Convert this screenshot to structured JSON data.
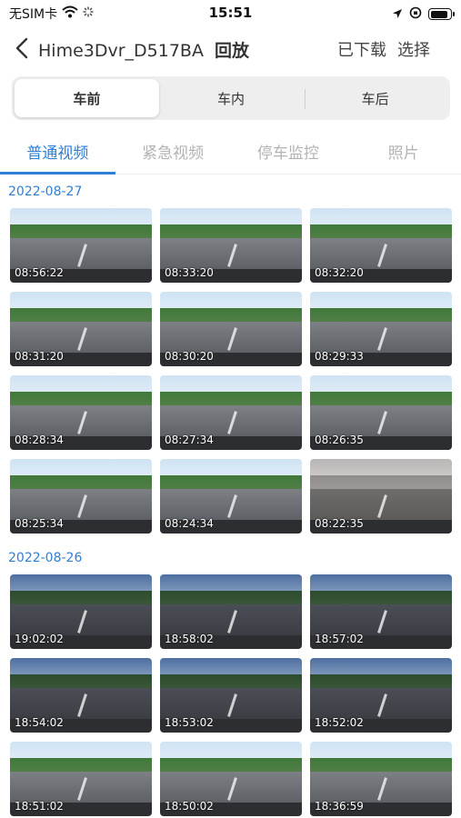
{
  "status_bar": {
    "carrier": "无SIM卡",
    "time": "15:51",
    "icons": [
      "wifi-icon",
      "activity-icon",
      "location-arrow-icon",
      "lock-rotation-icon",
      "battery-icon"
    ],
    "battery_level": 0.9
  },
  "nav": {
    "title": "Hime3Dvr_D517BA",
    "subtitle": "回放",
    "downloaded_label": "已下载",
    "select_label": "选择"
  },
  "camera_segments": [
    {
      "label": "车前",
      "active": true
    },
    {
      "label": "车内",
      "active": false
    },
    {
      "label": "车后",
      "active": false
    }
  ],
  "tabs": [
    {
      "label": "普通视频",
      "active": true
    },
    {
      "label": "紧急视频",
      "active": false
    },
    {
      "label": "停车监控",
      "active": false
    },
    {
      "label": "照片",
      "active": false
    }
  ],
  "accent_color": "#2f7fd6",
  "sections": [
    {
      "date": "2022-08-27",
      "videos": [
        {
          "time": "08:56:22",
          "scene": "day"
        },
        {
          "time": "08:33:20",
          "scene": "day"
        },
        {
          "time": "08:32:20",
          "scene": "day"
        },
        {
          "time": "08:31:20",
          "scene": "day"
        },
        {
          "time": "08:30:20",
          "scene": "day"
        },
        {
          "time": "08:29:33",
          "scene": "day"
        },
        {
          "time": "08:28:34",
          "scene": "day"
        },
        {
          "time": "08:27:34",
          "scene": "day"
        },
        {
          "time": "08:26:35",
          "scene": "day"
        },
        {
          "time": "08:25:34",
          "scene": "day"
        },
        {
          "time": "08:24:34",
          "scene": "day"
        },
        {
          "time": "08:22:35",
          "scene": "garage"
        }
      ]
    },
    {
      "date": "2022-08-26",
      "videos": [
        {
          "time": "19:02:02",
          "scene": "dusk"
        },
        {
          "time": "18:58:02",
          "scene": "dusk"
        },
        {
          "time": "18:57:02",
          "scene": "dusk"
        },
        {
          "time": "18:54:02",
          "scene": "dusk"
        },
        {
          "time": "18:53:02",
          "scene": "dusk"
        },
        {
          "time": "18:52:02",
          "scene": "dusk"
        },
        {
          "time": "18:51:02",
          "scene": "day"
        },
        {
          "time": "18:50:02",
          "scene": "day"
        },
        {
          "time": "18:36:59",
          "scene": "day"
        }
      ]
    }
  ]
}
